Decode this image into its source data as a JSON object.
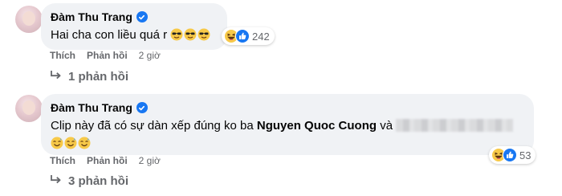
{
  "comments": [
    {
      "author": "Đàm Thu Trang",
      "text": "Hai cha con liều quá r",
      "reactions_count": "242",
      "actions": {
        "like": "Thích",
        "reply": "Phản hồi",
        "time": "2 giờ"
      },
      "replies_label": "1 phản hồi"
    },
    {
      "author": "Đàm Thu Trang",
      "text_before": "Clip này đã có sự dàn xếp đúng ko ba ",
      "mention": "Nguyen Quoc Cuong",
      "text_after": " và",
      "reactions_count": "53",
      "actions": {
        "like": "Thích",
        "reply": "Phản hồi",
        "time": "2 giờ"
      },
      "replies_label": "3 phản hồi"
    }
  ],
  "icons": {
    "verified": "verified-badge-icon",
    "reply_arrow": "reply-arrow-icon",
    "haha": "haha-reaction-icon",
    "like": "like-reaction-icon",
    "sunglasses": "sunglasses-emoji-icon",
    "sweat_smile": "sweat-smile-emoji-icon"
  },
  "colors": {
    "accent": "#1877f2",
    "bubble": "#f0f2f5",
    "secondary_text": "#65676b"
  }
}
